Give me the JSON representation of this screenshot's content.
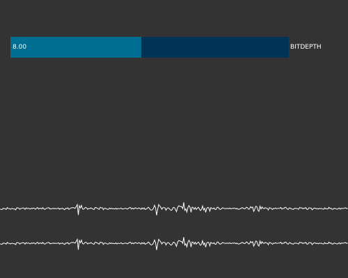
{
  "slider": {
    "value_text": "8.00",
    "label": "BITDEPTH",
    "fill_fraction": 0.47,
    "track_color": "#003355",
    "fill_color": "#016f91"
  },
  "background_color": "#333333",
  "waveform_color": "#ffffff"
}
